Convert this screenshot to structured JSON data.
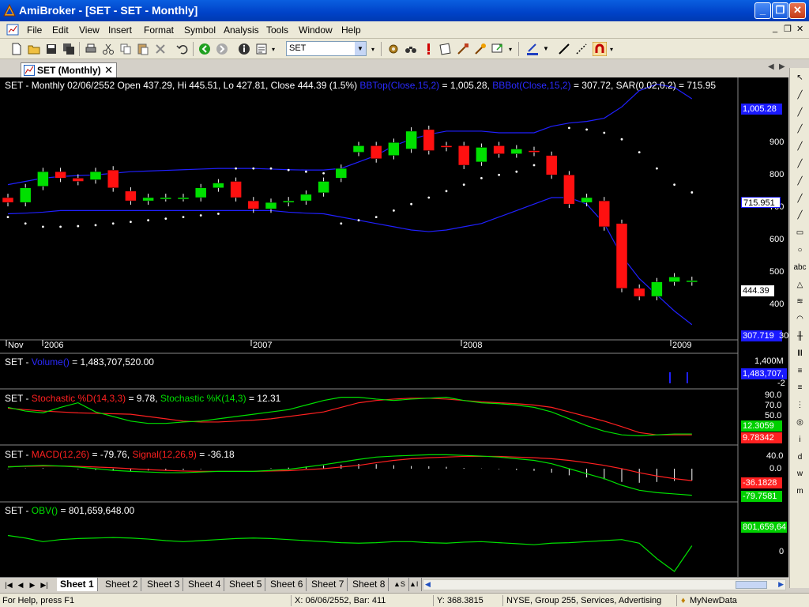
{
  "window": {
    "title": "AmiBroker - [SET - SET - Monthly]",
    "minimize": "_",
    "maximize": "❐",
    "close": "✕"
  },
  "menu": {
    "items": [
      "File",
      "Edit",
      "View",
      "Insert",
      "Format",
      "Symbol",
      "Analysis",
      "Tools",
      "Window",
      "Help"
    ],
    "mdi_min": "_",
    "mdi_restore": "❐",
    "mdi_close": "✕"
  },
  "toolbar": {
    "symbol": "SET"
  },
  "doc_tab": {
    "label": "SET (Monthly)",
    "close": "✕"
  },
  "price_pane": {
    "title_prefix": "SET - Monthly 02/06/2552 Open 437.29, Hi 445.51, Lo 427.81, Close 444.39 (1.5%)",
    "bbtop_label": "BBTop(Close,15,2)",
    "bbtop_value": " = 1,005.28,",
    "bbbot_label": "BBBot(Close,15,2)",
    "bbbot_value": " = 307.72,",
    "sar_text": "SAR(0.02,0.2) = 715.95",
    "y_ticks": [
      "900",
      "800",
      "700",
      "600",
      "500",
      "400",
      "300"
    ],
    "box_bbtop": "1,005.28",
    "box_sar": "715.951",
    "box_close": "444.39",
    "box_bbbot": "307.719",
    "x_labels": [
      "Nov",
      "2006",
      "2007",
      "2008",
      "2009"
    ]
  },
  "volume_pane": {
    "prefix": "SET - ",
    "label": "Volume()",
    "value": " = 1,483,707,520.00",
    "tick_top": "1,400M",
    "box_value": "1,483,707,",
    "tick_bottom": "-2"
  },
  "stoch_pane": {
    "prefix": "SET - ",
    "d_label": "Stochastic %D(14,3,3)",
    "d_value": " = 9.78, ",
    "k_label": "Stochastic %K(14,3)",
    "k_value": " = 12.31",
    "ticks": [
      "90.0",
      "70.0",
      "50.0",
      "30.0"
    ],
    "box_k": "12.3059",
    "box_d": "9.78342"
  },
  "macd_pane": {
    "prefix": "SET - ",
    "macd_label": "MACD(12,26)",
    "macd_value": " = -79.76, ",
    "signal_label": "Signal(12,26,9)",
    "signal_value": " = -36.18",
    "ticks": [
      "40.0",
      "0.0"
    ],
    "box_signal": "-36.1828",
    "box_macd": "-79.7581"
  },
  "obv_pane": {
    "prefix": "SET - ",
    "label": "OBV()",
    "value": " = 801,659,648.00",
    "box_value": "801,659,64",
    "tick": "0"
  },
  "draw_tools": [
    "↖",
    "╱",
    "╱",
    "╱",
    "╱",
    "╱",
    "╱",
    "╱",
    "╱",
    "▭",
    "○",
    "abc",
    "△",
    "≋",
    "◠",
    "╫",
    "Ⅲ",
    "≡",
    "≡",
    "⋮",
    "◎",
    "i",
    "d",
    "w",
    "m"
  ],
  "sheets": {
    "nav": [
      "|◀",
      "◀",
      "▶",
      "▶|"
    ],
    "tabs": [
      "Sheet 1",
      "Sheet 2",
      "Sheet 3",
      "Sheet 4",
      "Sheet 5",
      "Sheet 6",
      "Sheet 7",
      "Sheet 8"
    ],
    "extra": [
      "▲S",
      "▲I"
    ],
    "scroll_left": "◀",
    "scroll_right": "▶"
  },
  "status": {
    "help": "For Help, press F1",
    "x": "X: 06/06/2552, Bar: 411",
    "y": "Y: 368.3815",
    "info": "NYSE, Group 255, Services, Advertising",
    "db": "MyNewData"
  },
  "colors": {
    "up": "#00e000",
    "down": "#ff1010",
    "band": "#2020ff",
    "sar": "#ffffff",
    "stoch_d": "#ff2020",
    "stoch_k": "#00e000",
    "obv": "#00e000"
  },
  "chart_data": {
    "type": "candlestick",
    "x": [
      "Nov",
      "2006",
      "2007",
      "2008",
      "2009"
    ],
    "y_range": [
      300,
      1005
    ],
    "candles": [
      {
        "o": 700,
        "c": 685
      },
      {
        "o": 685,
        "c": 730
      },
      {
        "o": 735,
        "c": 780
      },
      {
        "o": 780,
        "c": 760
      },
      {
        "o": 760,
        "c": 750
      },
      {
        "o": 755,
        "c": 780
      },
      {
        "o": 785,
        "c": 730
      },
      {
        "o": 720,
        "c": 690
      },
      {
        "o": 690,
        "c": 700
      },
      {
        "o": 700,
        "c": 700
      },
      {
        "o": 700,
        "c": 700
      },
      {
        "o": 700,
        "c": 730
      },
      {
        "o": 730,
        "c": 745
      },
      {
        "o": 750,
        "c": 700
      },
      {
        "o": 690,
        "c": 665
      },
      {
        "o": 665,
        "c": 685
      },
      {
        "o": 685,
        "c": 690
      },
      {
        "o": 690,
        "c": 710
      },
      {
        "o": 715,
        "c": 750
      },
      {
        "o": 760,
        "c": 790
      },
      {
        "o": 840,
        "c": 860
      },
      {
        "o": 860,
        "c": 820
      },
      {
        "o": 830,
        "c": 870
      },
      {
        "o": 850,
        "c": 905
      },
      {
        "o": 910,
        "c": 845
      },
      {
        "o": 860,
        "c": 855
      },
      {
        "o": 860,
        "c": 800
      },
      {
        "o": 810,
        "c": 855
      },
      {
        "o": 860,
        "c": 835
      },
      {
        "o": 835,
        "c": 850
      },
      {
        "o": 845,
        "c": 840
      },
      {
        "o": 830,
        "c": 770
      },
      {
        "o": 770,
        "c": 680
      },
      {
        "o": 685,
        "c": 700
      },
      {
        "o": 690,
        "c": 610
      },
      {
        "o": 620,
        "c": 420
      },
      {
        "o": 420,
        "c": 395
      },
      {
        "o": 395,
        "c": 440
      },
      {
        "o": 440,
        "c": 455
      },
      {
        "o": 440,
        "c": 444
      }
    ],
    "bb_top": [
      740,
      750,
      760,
      765,
      768,
      770,
      775,
      780,
      782,
      784,
      786,
      788,
      790,
      790,
      790,
      788,
      786,
      785,
      785,
      790,
      810,
      830,
      860,
      880,
      895,
      905,
      905,
      905,
      900,
      900,
      900,
      920,
      930,
      935,
      945,
      980,
      1030,
      1050,
      1040,
      1005
    ],
    "bb_bot": [
      650,
      652,
      655,
      660,
      660,
      660,
      660,
      660,
      660,
      660,
      660,
      660,
      660,
      660,
      660,
      660,
      655,
      652,
      650,
      640,
      630,
      620,
      610,
      600,
      595,
      600,
      610,
      620,
      640,
      660,
      680,
      700,
      700,
      680,
      620,
      520,
      450,
      400,
      350,
      308
    ],
    "sar": [
      640,
      620,
      610,
      610,
      612,
      615,
      620,
      625,
      630,
      635,
      640,
      645,
      650,
      790,
      790,
      790,
      785,
      780,
      775,
      620,
      630,
      640,
      660,
      680,
      700,
      720,
      740,
      760,
      770,
      780,
      800,
      820,
      915,
      910,
      900,
      880,
      840,
      790,
      740,
      716
    ],
    "stoch_d": [
      68,
      65,
      62,
      60,
      58,
      57,
      56,
      55,
      50,
      45,
      40,
      38,
      38,
      40,
      42,
      45,
      50,
      55,
      60,
      70,
      80,
      85,
      88,
      90,
      90,
      88,
      85,
      82,
      80,
      78,
      75,
      70,
      60,
      50,
      40,
      28,
      15,
      10,
      10,
      10
    ],
    "stoch_k": [
      70,
      62,
      58,
      70,
      80,
      60,
      50,
      40,
      35,
      35,
      38,
      40,
      45,
      50,
      55,
      60,
      65,
      75,
      85,
      92,
      92,
      88,
      85,
      88,
      90,
      92,
      85,
      80,
      78,
      75,
      70,
      60,
      45,
      30,
      18,
      10,
      8,
      10,
      12,
      12
    ],
    "macd": [
      5,
      8,
      10,
      8,
      5,
      0,
      -5,
      -8,
      -10,
      -12,
      -12,
      -10,
      -8,
      -8,
      -8,
      -5,
      -2,
      5,
      12,
      20,
      28,
      35,
      38,
      40,
      42,
      42,
      40,
      38,
      35,
      30,
      25,
      15,
      0,
      -15,
      -30,
      -50,
      -65,
      -72,
      -76,
      -80
    ],
    "signal": [
      6,
      7,
      8,
      8,
      7,
      5,
      3,
      0,
      -3,
      -5,
      -7,
      -8,
      -8,
      -8,
      -8,
      -7,
      -6,
      -3,
      0,
      5,
      10,
      18,
      25,
      30,
      33,
      35,
      37,
      37,
      37,
      35,
      33,
      30,
      25,
      18,
      10,
      0,
      -12,
      -22,
      -30,
      -36
    ],
    "obv": [
      0.3,
      0.35,
      0.42,
      0.38,
      0.36,
      0.35,
      0.34,
      0.35,
      0.37,
      0.4,
      0.42,
      0.4,
      0.38,
      0.36,
      0.35,
      0.36,
      0.38,
      0.4,
      0.42,
      0.44,
      0.45,
      0.44,
      0.42,
      0.42,
      0.44,
      0.45,
      0.43,
      0.42,
      0.44,
      0.46,
      0.48,
      0.45,
      0.44,
      0.42,
      0.4,
      0.38,
      0.45,
      0.75,
      1.0,
      0.5
    ]
  }
}
